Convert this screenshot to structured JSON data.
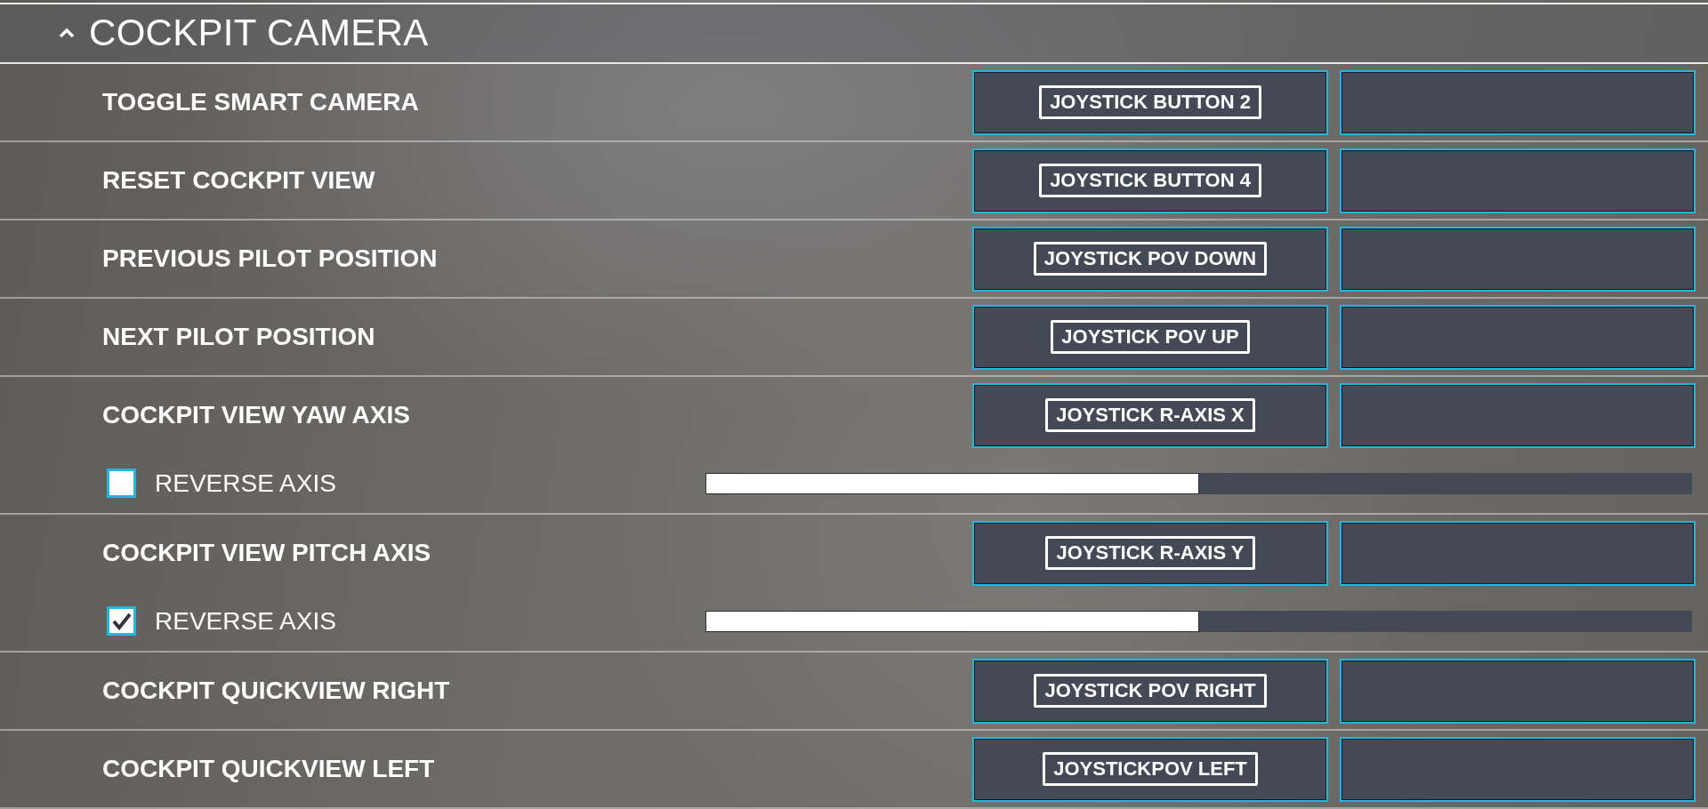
{
  "section": {
    "title": "COCKPIT CAMERA",
    "expanded": true
  },
  "bindings": [
    {
      "kind": "button",
      "action": "TOGGLE SMART CAMERA",
      "primary": "JOYSTICK BUTTON 2"
    },
    {
      "kind": "button",
      "action": "RESET COCKPIT VIEW",
      "primary": "JOYSTICK BUTTON 4"
    },
    {
      "kind": "button",
      "action": "PREVIOUS PILOT POSITION",
      "primary": "JOYSTICK POV DOWN"
    },
    {
      "kind": "button",
      "action": "NEXT PILOT POSITION",
      "primary": "JOYSTICK POV UP"
    },
    {
      "kind": "axis",
      "action": "COCKPIT VIEW YAW AXIS",
      "primary": "JOYSTICK R-AXIS X",
      "reverse_label": "REVERSE AXIS",
      "reversed": false,
      "level": 0.5
    },
    {
      "kind": "axis",
      "action": "COCKPIT VIEW PITCH AXIS",
      "primary": "JOYSTICK R-AXIS Y",
      "reverse_label": "REVERSE AXIS",
      "reversed": true,
      "level": 0.5
    },
    {
      "kind": "button",
      "action": "COCKPIT QUICKVIEW RIGHT",
      "primary": "JOYSTICK POV RIGHT"
    },
    {
      "kind": "button",
      "action": "COCKPIT QUICKVIEW LEFT",
      "primary": "JOYSTICKPOV LEFT"
    }
  ]
}
